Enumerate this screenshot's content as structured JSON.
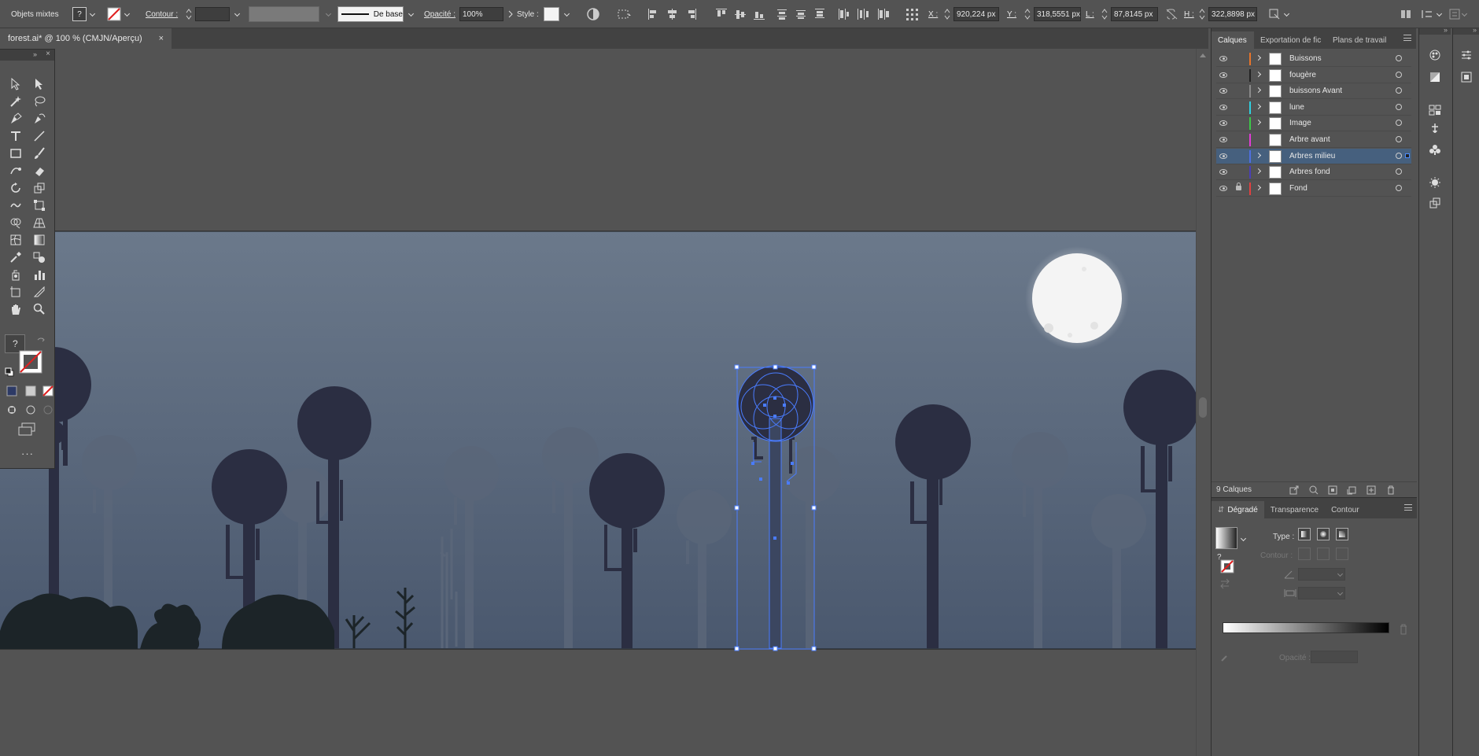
{
  "control_bar": {
    "selection_label": "Objets mixtes",
    "fill_value": "?",
    "stroke_label": "Contour :",
    "stroke_style_label": "De base",
    "opacity_label": "Opacité :",
    "opacity_value": "100%",
    "style_label": "Style :",
    "x_label": "X :",
    "x_value": "920,224 px",
    "y_label": "Y :",
    "y_value": "318,5551 px",
    "w_label": "L :",
    "w_value": "87,8145 px",
    "h_label": "H :",
    "h_value": "322,8898 px"
  },
  "document": {
    "tab_title": "forest.ai* @ 100 % (CMJN/Aperçu)",
    "close_glyph": "×"
  },
  "tools": {
    "fill_question": "?"
  },
  "layers_panel": {
    "tabs": [
      "Calques",
      "Exportation de fic",
      "Plans de travail"
    ],
    "layers": [
      {
        "name": "Buissons",
        "color": "#e8742a",
        "locked": false,
        "expandable": true,
        "selected": false
      },
      {
        "name": "fougère",
        "color": "#222222",
        "locked": false,
        "expandable": true,
        "selected": false
      },
      {
        "name": "buissons Avant",
        "color": "#8a8a8a",
        "locked": false,
        "expandable": true,
        "selected": false
      },
      {
        "name": "lune",
        "color": "#2fd0e0",
        "locked": false,
        "expandable": true,
        "selected": false
      },
      {
        "name": "Image",
        "color": "#3cc848",
        "locked": false,
        "expandable": true,
        "selected": false
      },
      {
        "name": "Arbre avant",
        "color": "#e23cd8",
        "locked": false,
        "expandable": false,
        "selected": false
      },
      {
        "name": "Arbres milieu",
        "color": "#4f6fe0",
        "locked": false,
        "expandable": true,
        "selected": true
      },
      {
        "name": "Arbres fond",
        "color": "#4a3fb8",
        "locked": false,
        "expandable": true,
        "selected": false
      },
      {
        "name": "Fond",
        "color": "#e24040",
        "locked": true,
        "expandable": true,
        "selected": false
      }
    ],
    "count_label": "9 Calques"
  },
  "gradient_panel": {
    "tabs": [
      "Dégradé",
      "Transparence",
      "Contour"
    ],
    "type_label": "Type :",
    "stroke_label": "Contour :",
    "opacity_label": "Opacité :",
    "fill_question": "?"
  },
  "colors": {
    "sky_top": "#6b798b",
    "sky_bottom": "#4a586e",
    "tree_front": "#2b2e42",
    "tree_far": "#5a6679",
    "bush": "#1c2428",
    "moon": "#f4f4f4",
    "selection": "#4a7cff",
    "panel_bg": "#535353",
    "selected_layer": "#46607e"
  }
}
